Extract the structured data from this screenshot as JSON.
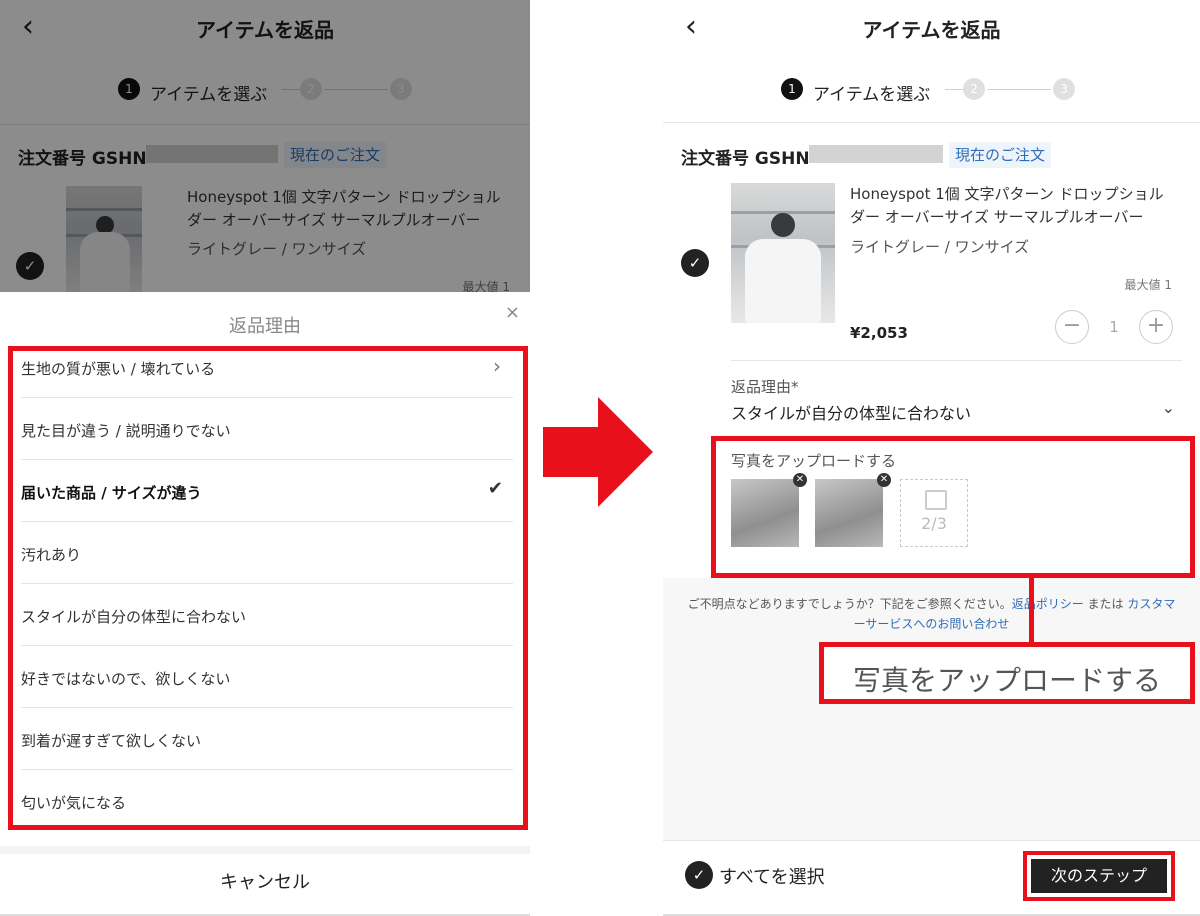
{
  "header": {
    "back_icon": "chevron-left-icon",
    "title": "アイテムを返品"
  },
  "stepper": {
    "step1_number": "1",
    "step1_label": "アイテムを選ぶ",
    "step2_number": "2",
    "step3_number": "3"
  },
  "order": {
    "label": "注文番号 GSHN",
    "badge": "現在のご注文"
  },
  "product": {
    "name": "Honeyspot 1個 文字パターン ドロップショルダー オーバーサイズ サーマルプルオーバー",
    "variant": "ライトグレー / ワンサイズ",
    "max_label": "最大値 1",
    "price": "¥2,053",
    "quantity": "1",
    "minus": "−",
    "plus": "+"
  },
  "sheet": {
    "title": "返品理由",
    "close": "×",
    "reasons": [
      {
        "label": "生地の質が悪い / 壊れている",
        "selected": false,
        "chevron": "›"
      },
      {
        "label": "見た目が違う / 説明通りでない",
        "selected": false
      },
      {
        "label": "届いた商品 / サイズが違う",
        "selected": true,
        "check": "✔"
      },
      {
        "label": "汚れあり",
        "selected": false
      },
      {
        "label": "スタイルが自分の体型に合わない",
        "selected": false
      },
      {
        "label": "好きではないので、欲しくない",
        "selected": false
      },
      {
        "label": "到着が遅すぎて欲しくない",
        "selected": false
      },
      {
        "label": "匂いが気になる",
        "selected": false
      }
    ],
    "cancel": "キャンセル"
  },
  "right": {
    "reason_label": "返品理由*",
    "reason_value": "スタイルが自分の体型に合わない",
    "reason_chevron": "⌄",
    "upload_label": "写真をアップロードする",
    "photo_remove": "✕",
    "photo_count": "2/3",
    "help_text_1": "ご不明点などありますでしょうか？下記をご参照ください。",
    "help_link_1": "返品ポリシー",
    "help_text_2": " または ",
    "help_link_2": "カスタマーサービスへのお問い合わせ",
    "callout": "写真をアップロードする",
    "select_all": "すべてを選択",
    "next_step": "次のステップ"
  },
  "check_mark": "✓",
  "colors": {
    "annotation_red": "#e8101a",
    "link_blue": "#2f6db5",
    "dark": "#222222"
  }
}
